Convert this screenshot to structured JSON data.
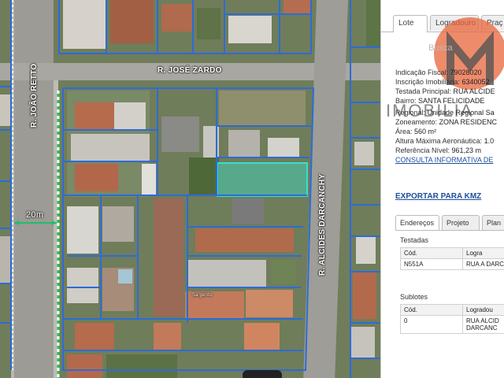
{
  "map": {
    "streets": {
      "jose_zardo": "R. JOSÉ ZARDO",
      "joao_retto": "R. JOÃO RETTO",
      "alcides_darcanchy": "R. ALCIDES DARCANCHY"
    },
    "measure_label": "20m",
    "building_label": "Sa'gento"
  },
  "panel": {
    "tabs": [
      "Lote",
      "Logradouro",
      "Praç"
    ],
    "watermark_search": "Busca",
    "brand_text": "IMOBILIA",
    "info_rows": [
      {
        "key": "Indicação Fiscal: ",
        "val": "79028020"
      },
      {
        "key": "Inscrição Imobiliária: ",
        "val": "6340052"
      },
      {
        "key": "Testada Principal: ",
        "val": "RUA ALCIDE"
      },
      {
        "key": "Bairro: ",
        "val": "SANTA FELICIDADE"
      },
      {
        "key": "Regional: ",
        "val": "Unidade Regional Sa"
      },
      {
        "key": "Zoneamento: ",
        "val": "ZONA RESIDENC"
      },
      {
        "key": "Área: ",
        "val": "560 m²"
      },
      {
        "key": "Altura Máxima Aeronáutica: ",
        "val": "1.0"
      },
      {
        "key": "Referência Nível: ",
        "val": "961,23 m"
      }
    ],
    "consulta_link": "CONSULTA INFORMATIVA DE",
    "export_link": "EXPORTAR PARA KMZ",
    "subtabs": [
      "Endereços",
      "Projeto",
      "Plan"
    ],
    "testadas": {
      "title": "Testadas",
      "headers": [
        "Cód.",
        "Logra"
      ],
      "rows": [
        [
          "N551A",
          "RUA A DARC"
        ]
      ]
    },
    "sublotes": {
      "title": "Sublotes",
      "headers": [
        "Cód.",
        "Logradou"
      ],
      "rows": [
        [
          "0",
          "RUA ALCID DARCANC"
        ]
      ]
    },
    "colors": {
      "link": "#1d4f9a",
      "parcel": "#2d6bd8",
      "highlight": "#3fd6c2",
      "logo": "#e8643a"
    }
  }
}
